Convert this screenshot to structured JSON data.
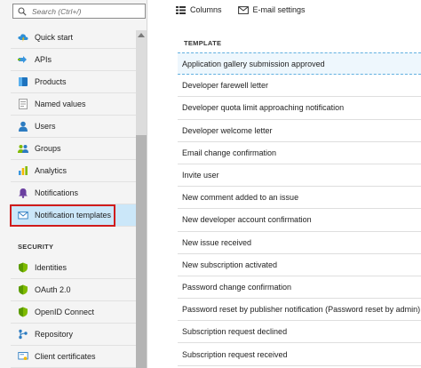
{
  "search": {
    "placeholder": "Search (Ctrl+/)"
  },
  "sidebar": {
    "items": [
      {
        "label": "Quick start",
        "icon": "cloud-lightning-icon"
      },
      {
        "label": "APIs",
        "icon": "api-arrow-icon"
      },
      {
        "label": "Products",
        "icon": "product-box-icon"
      },
      {
        "label": "Named values",
        "icon": "named-values-list-icon"
      },
      {
        "label": "Users",
        "icon": "user-icon"
      },
      {
        "label": "Groups",
        "icon": "group-icon"
      },
      {
        "label": "Analytics",
        "icon": "analytics-bar-icon"
      },
      {
        "label": "Notifications",
        "icon": "bell-icon"
      },
      {
        "label": "Notification templates",
        "icon": "envelope-icon"
      }
    ],
    "security_heading": "SECURITY",
    "security_items": [
      {
        "label": "Identities",
        "icon": "shield-icon"
      },
      {
        "label": "OAuth 2.0",
        "icon": "shield-icon"
      },
      {
        "label": "OpenID Connect",
        "icon": "shield-icon"
      },
      {
        "label": "Repository",
        "icon": "repository-icon"
      },
      {
        "label": "Client certificates",
        "icon": "certificate-icon"
      }
    ]
  },
  "toolbar": {
    "columns_label": "Columns",
    "email_settings_label": "E-mail settings"
  },
  "table": {
    "header": "TEMPLATE",
    "rows": [
      "Application gallery submission approved",
      "Developer farewell letter",
      "Developer quota limit approaching notification",
      "Developer welcome letter",
      "Email change confirmation",
      "Invite user",
      "New comment added to an issue",
      "New developer account confirmation",
      "New issue received",
      "New subscription activated",
      "Password change confirmation",
      "Password reset by publisher notification (Password reset by admin)",
      "Subscription request declined",
      "Subscription request received"
    ]
  },
  "colors": {
    "selected_nav": "#cbe7f9",
    "highlight_border": "#d01c1c",
    "selected_row_border": "#62b0e0"
  }
}
